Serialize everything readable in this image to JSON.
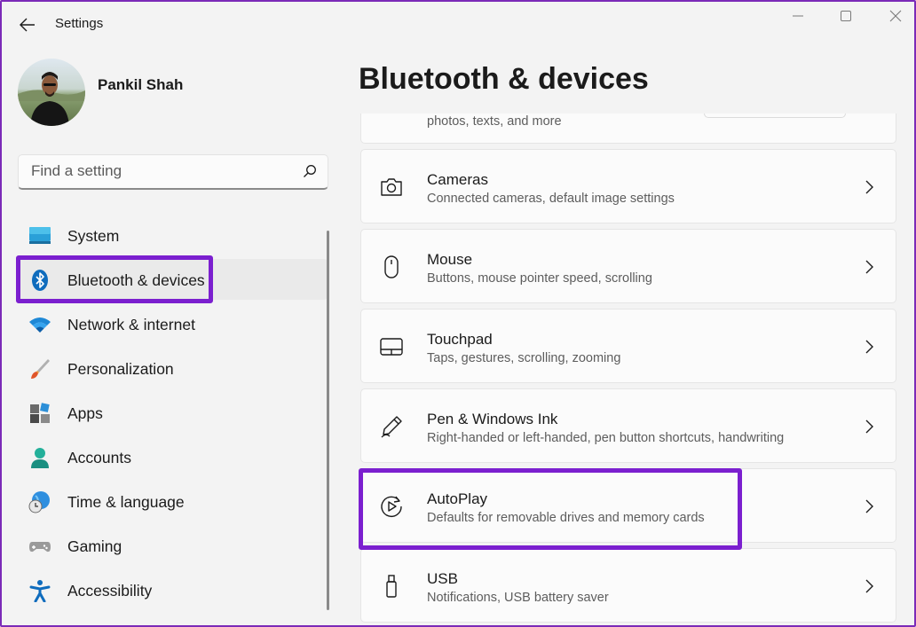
{
  "window": {
    "title": "Settings",
    "accent_color": "#7b1fcf"
  },
  "user": {
    "name": "Pankil Shah"
  },
  "search": {
    "placeholder": "Find a setting"
  },
  "nav": {
    "items": [
      {
        "label": "System",
        "icon": "system-icon"
      },
      {
        "label": "Bluetooth & devices",
        "icon": "bluetooth-icon",
        "selected": true
      },
      {
        "label": "Network & internet",
        "icon": "wifi-icon"
      },
      {
        "label": "Personalization",
        "icon": "brush-icon"
      },
      {
        "label": "Apps",
        "icon": "apps-icon"
      },
      {
        "label": "Accounts",
        "icon": "person-icon"
      },
      {
        "label": "Time & language",
        "icon": "globe-clock-icon"
      },
      {
        "label": "Gaming",
        "icon": "gamepad-icon"
      },
      {
        "label": "Accessibility",
        "icon": "accessibility-icon"
      }
    ]
  },
  "main": {
    "title": "Bluetooth & devices",
    "partial_desc": "photos, texts, and more",
    "cards": [
      {
        "title": "Cameras",
        "desc": "Connected cameras, default image settings",
        "icon": "camera-icon"
      },
      {
        "title": "Mouse",
        "desc": "Buttons, mouse pointer speed, scrolling",
        "icon": "mouse-icon"
      },
      {
        "title": "Touchpad",
        "desc": "Taps, gestures, scrolling, zooming",
        "icon": "touchpad-icon"
      },
      {
        "title": "Pen & Windows Ink",
        "desc": "Right-handed or left-handed, pen button shortcuts, handwriting",
        "icon": "pen-icon"
      },
      {
        "title": "AutoPlay",
        "desc": "Defaults for removable drives and memory cards",
        "icon": "autoplay-icon"
      },
      {
        "title": "USB",
        "desc": "Notifications, USB battery saver",
        "icon": "usb-icon"
      }
    ]
  }
}
